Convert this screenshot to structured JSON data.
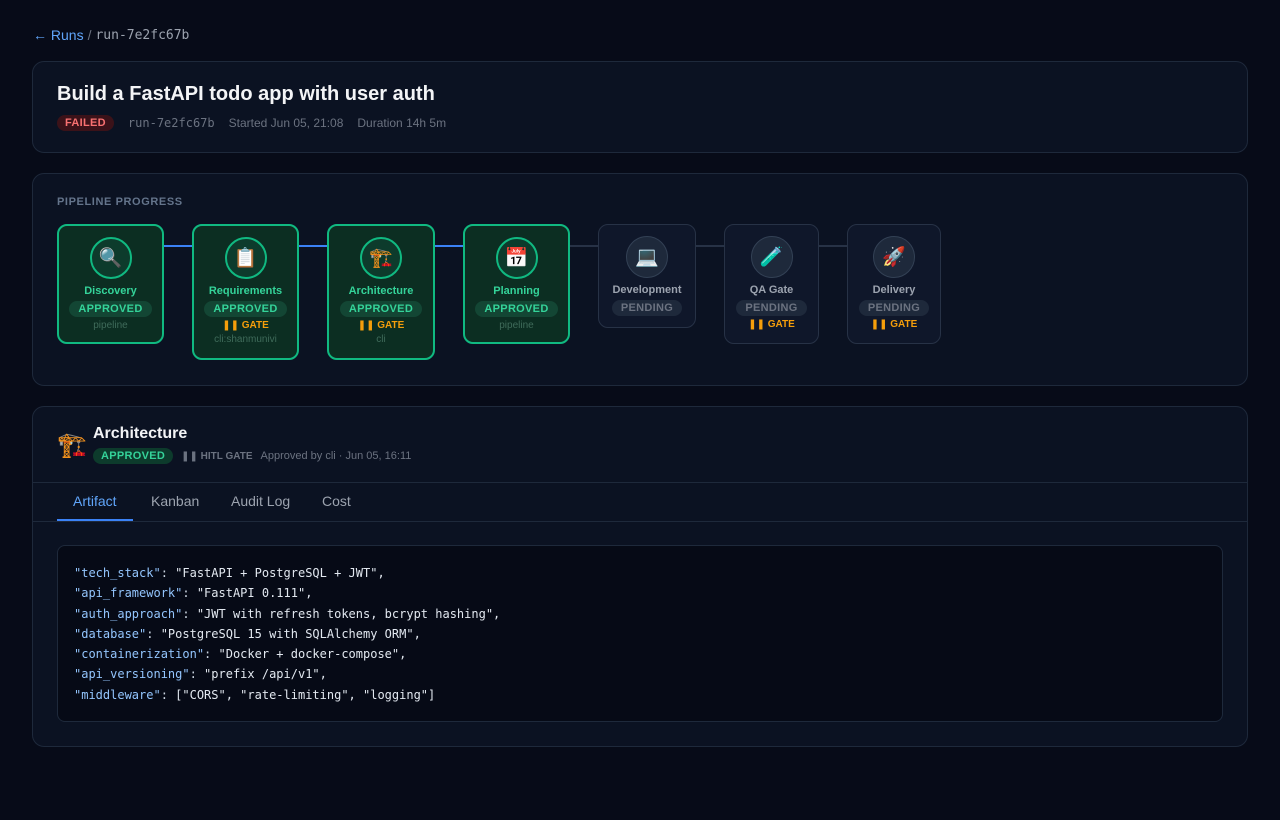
{
  "breadcrumb": {
    "back_label": "← Runs",
    "separator": "/",
    "current": "run-7e2fc67b"
  },
  "run": {
    "title": "Build a FastAPI todo app with user auth",
    "status": "FAILED",
    "run_id": "run-7e2fc67b",
    "started": "Started Jun 05, 21:08",
    "duration": "Duration 14h 5m"
  },
  "pipeline": {
    "label": "PIPELINE PROGRESS",
    "stages": [
      {
        "name": "Discovery",
        "icon": "🔍",
        "icon_name": "magnifier-icon",
        "status": "APPROVED",
        "gate": "",
        "by": "pipeline"
      },
      {
        "name": "Requirements",
        "icon": "📋",
        "icon_name": "clipboard-icon",
        "status": "APPROVED",
        "gate": "❚❚ GATE",
        "by": "cli:shanmunivi"
      },
      {
        "name": "Architecture",
        "icon": "🏗️",
        "icon_name": "crane-icon",
        "status": "APPROVED",
        "gate": "❚❚ GATE",
        "by": "cli"
      },
      {
        "name": "Planning",
        "icon": "📅",
        "icon_name": "calendar-icon",
        "status": "APPROVED",
        "gate": "",
        "by": "pipeline"
      },
      {
        "name": "Development",
        "icon": "💻",
        "icon_name": "laptop-icon",
        "status": "PENDING",
        "gate": "",
        "by": ""
      },
      {
        "name": "QA Gate",
        "icon": "🧪",
        "icon_name": "test-tube-icon",
        "status": "PENDING",
        "gate": "❚❚ GATE",
        "by": ""
      },
      {
        "name": "Delivery",
        "icon": "🚀",
        "icon_name": "rocket-icon",
        "status": "PENDING",
        "gate": "❚❚ GATE",
        "by": ""
      }
    ]
  },
  "detail": {
    "icon": "🏗️",
    "icon_name": "crane-icon",
    "title": "Architecture",
    "status": "APPROVED",
    "gate_label": "❚❚ HITL GATE",
    "approved_by": "Approved by cli · Jun 05, 16:11",
    "tabs": [
      "Artifact",
      "Kanban",
      "Audit Log",
      "Cost"
    ],
    "active_tab": "Artifact",
    "artifact": [
      {
        "key": "\"tech_stack\"",
        "value": "\"FastAPI + PostgreSQL + JWT\","
      },
      {
        "key": "\"api_framework\"",
        "value": "\"FastAPI 0.111\","
      },
      {
        "key": "\"auth_approach\"",
        "value": "\"JWT with refresh tokens, bcrypt hashing\","
      },
      {
        "key": "\"database\"",
        "value": "\"PostgreSQL 15 with SQLAlchemy ORM\","
      },
      {
        "key": "\"containerization\"",
        "value": "\"Docker + docker-compose\","
      },
      {
        "key": "\"api_versioning\"",
        "value": "\"prefix /api/v1\","
      },
      {
        "key": "\"middleware\"",
        "value": "[\"CORS\", \"rate-limiting\", \"logging\"]"
      }
    ]
  },
  "colors": {
    "background": "#070b18",
    "accent": "#3b82f6",
    "approved": "#10b981",
    "failed": "#f87171",
    "gate": "#f59e0b"
  }
}
